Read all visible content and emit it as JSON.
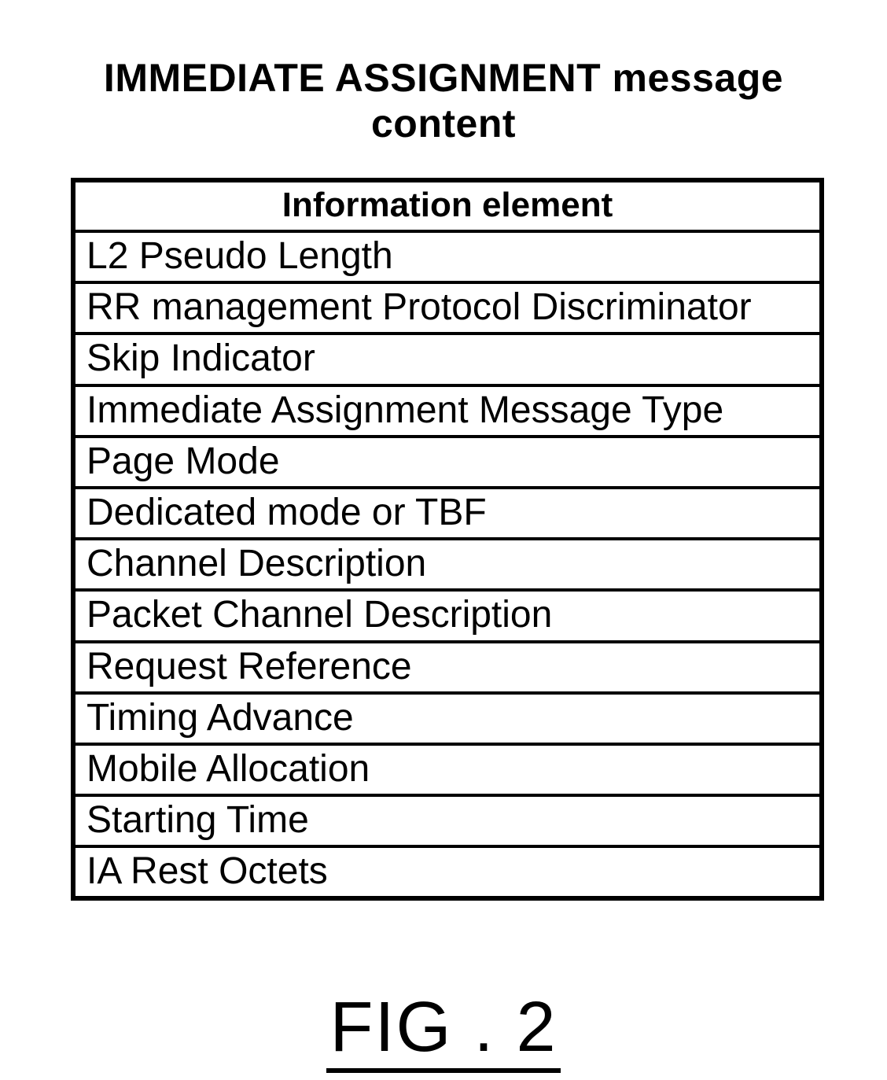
{
  "title": "IMMEDIATE ASSIGNMENT message content",
  "header": "Information element",
  "rows": [
    "L2 Pseudo Length",
    "RR management Protocol Discriminator",
    "Skip Indicator",
    "Immediate Assignment Message Type",
    "Page Mode",
    "Dedicated mode or TBF",
    "Channel Description",
    "Packet Channel Description",
    "Request Reference",
    "Timing Advance",
    "Mobile Allocation",
    "Starting Time",
    "IA Rest Octets"
  ],
  "figure_label": "FIG . 2"
}
